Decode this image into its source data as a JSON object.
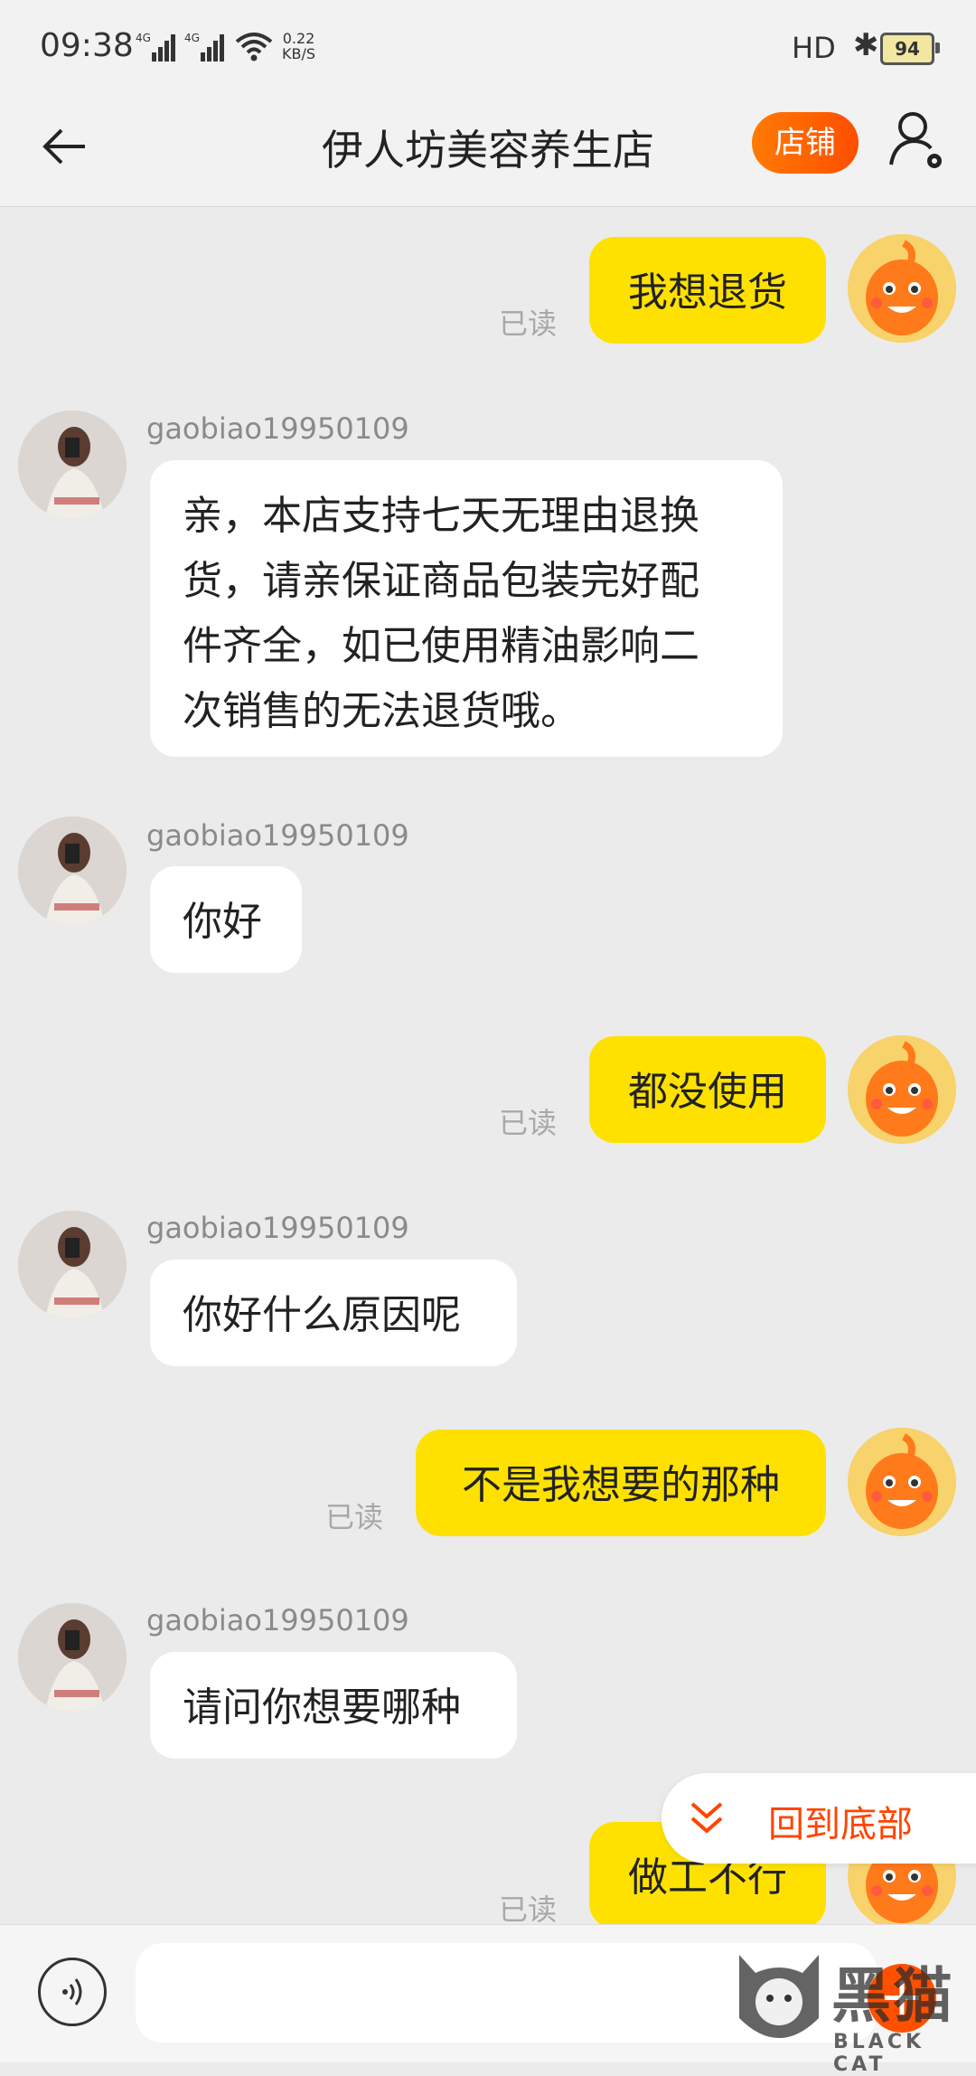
{
  "status_bar": {
    "time": "09:38",
    "net1": "4G",
    "net2": "4G",
    "speed_value": "0.22",
    "speed_unit": "KB/S",
    "hd": "HD",
    "battery": "94"
  },
  "header": {
    "title": "伊人坊美容养生店",
    "store_button": "店铺"
  },
  "messages": [
    {
      "side": "right",
      "text": "我想退货",
      "read": "已读"
    },
    {
      "side": "left",
      "sender": "gaobiao19950109",
      "lines": [
        "亲，本店支持七天无理由退换",
        "货，请亲保证商品包装完好配",
        "件齐全，如已使用精油影响二",
        "次销售的无法退货哦。"
      ]
    },
    {
      "side": "left",
      "sender": "gaobiao19950109",
      "text": "你好"
    },
    {
      "side": "right",
      "text": "都没使用",
      "read": "已读"
    },
    {
      "side": "left",
      "sender": "gaobiao19950109",
      "text": "你好什么原因呢"
    },
    {
      "side": "right",
      "text": "不是我想要的那种",
      "read": "已读"
    },
    {
      "side": "left",
      "sender": "gaobiao19950109",
      "text": "请问你想要哪种"
    },
    {
      "side": "right",
      "text": "做工不行",
      "read": "已读"
    }
  ],
  "back_to_bottom": "回到底部",
  "input": {
    "placeholder": ""
  },
  "watermark": {
    "brand": "黑猫",
    "brand_en": "BLACK CAT"
  },
  "colors": {
    "accent": "#ff5000",
    "my_bubble": "#ffe100",
    "other_bubble": "#ffffff",
    "background": "#ebebeb"
  }
}
